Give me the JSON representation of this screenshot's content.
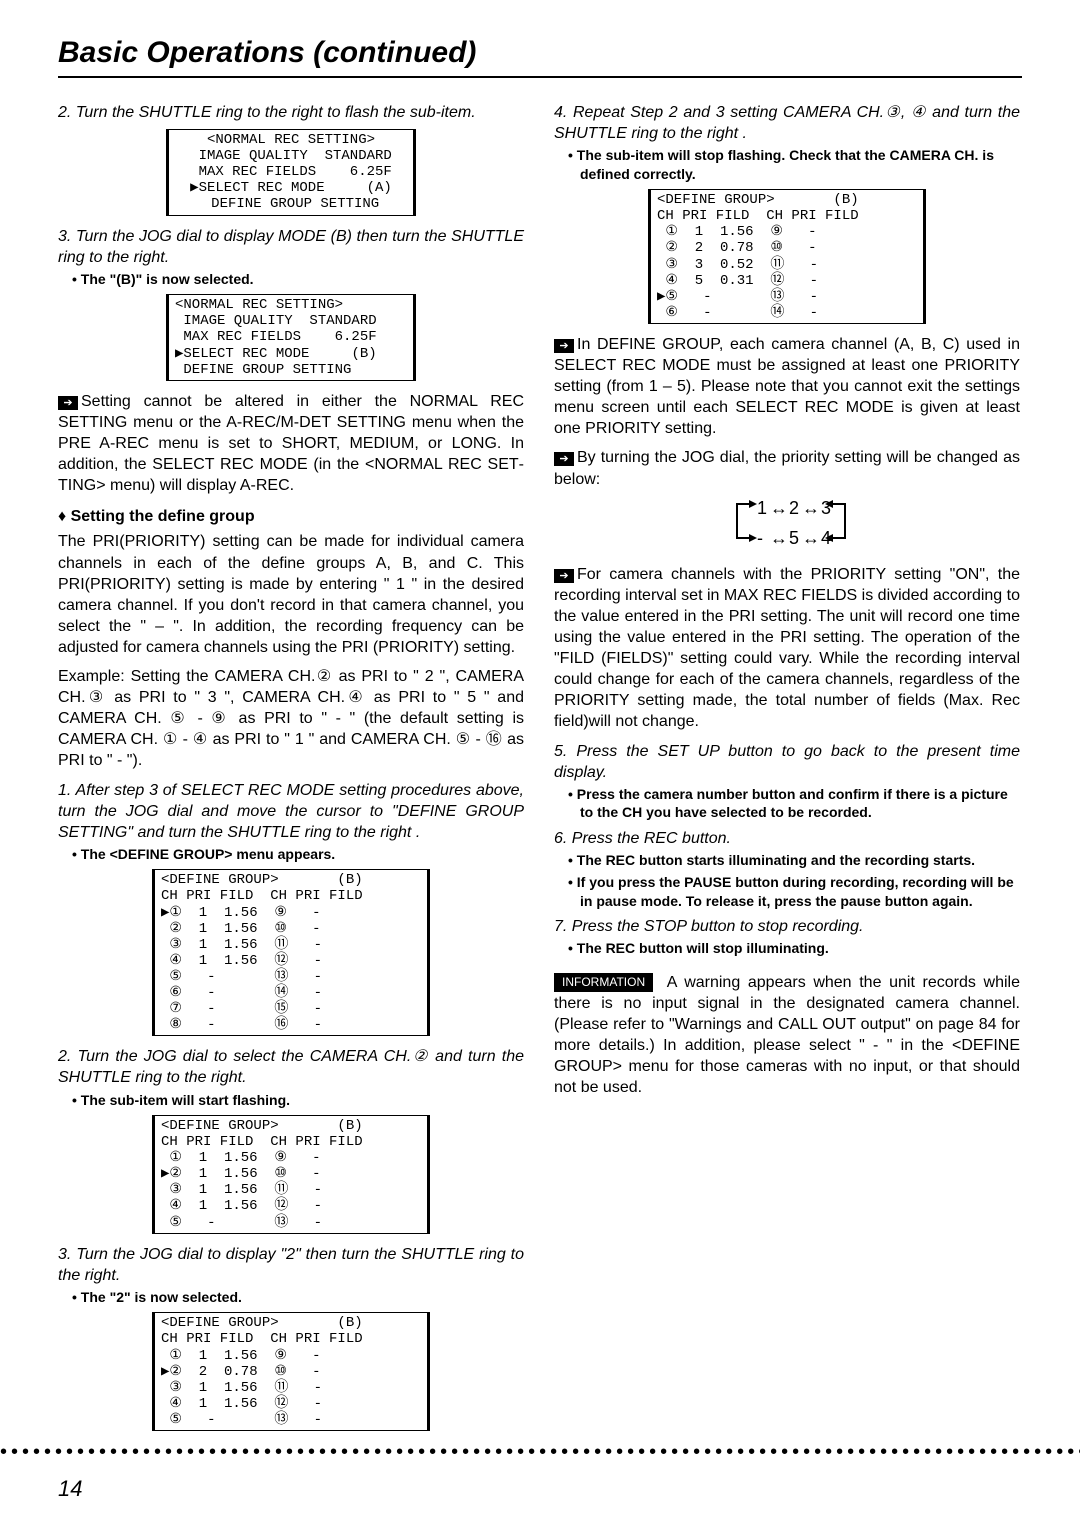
{
  "header": {
    "title": "Basic Operations (continued)"
  },
  "left": {
    "step2": "2. Turn the SHUTTLE ring to the right to flash the sub-item.",
    "menu1": "<NORMAL REC SETTING>\n IMAGE QUALITY  STANDARD\n MAX REC FIELDS    6.25F\n▶SELECT REC MODE     (A)\n DEFINE GROUP SETTING",
    "step3": "3. Turn the JOG dial to display MODE (B) then turn the SHUTTLE ring to the right.",
    "bullet3": "• The \"(B)\" is now selected.",
    "menu2": "<NORMAL REC SETTING>\n IMAGE QUALITY  STANDARD\n MAX REC FIELDS    6.25F\n▶SELECT REC MODE     (B)\n DEFINE GROUP SETTING",
    "note1": "Setting cannot be altered in either the NORMAL REC SETTING menu or the A-REC/M-DET SET­TING menu when the PRE A-REC menu is set to SHORT, MEDIUM, or LONG. In addition, the SE­LECT REC MODE (in the <NORMAL REC SET­TING> menu) will display A-REC.",
    "diamond": "♦ Setting the define group",
    "body1": "The PRI(PRIORITY) setting can be made for individual camera channels in each of the define groups A, B, and C. This PRI(PRIORITY) setting is made by entering \" 1 \" in the desired camera channel. If you don't record in that camera channel, you select the  \" – \". In addition, the re­cording frequency can be adjusted for camera channels using the PRI (PRIORITY) setting.",
    "example": "Example: Setting the CAMERA CH.② as PRI to \" 2 \", CAM­ERA CH.③ as PRI to \" 3 \", CAMERA CH.④ as PRI to \" 5 \"  and CAMERA CH. ⑤ - ⑨ as PRI to \" - \" (the default set­ting is CAMERA CH. ① - ④ as PRI to \" 1 \" and CAMERA CH. ⑤ - ⑯ as PRI to \" - \").",
    "dg_step1": "1. After step 3 of SELECT REC MODE setting procedures above, turn the JOG dial and move  the cursor to \"DEFINE GROUP SETTING\" and turn the SHUTTLE ring to the right .",
    "dg_bullet1": "• The <DEFINE GROUP> menu appears.",
    "menu3": "<DEFINE GROUP>       (B)\nCH PRI FILD  CH PRI FILD\n▶①  1  1.56  ⑨   -\n ②  1  1.56  ⑩   -\n ③  1  1.56  ⑪   -\n ④  1  1.56  ⑫   -\n ⑤   -       ⑬   -\n ⑥   -       ⑭   -\n ⑦   -       ⑮   -\n ⑧   -       ⑯   -",
    "dg_step2": "2. Turn the JOG dial to select the CAMERA CH.② and turn the SHUTTLE ring to the right.",
    "dg_bullet2": "• The sub-item will start flashing.",
    "menu4": "<DEFINE GROUP>       (B)\nCH PRI FILD  CH PRI FILD\n ①  1  1.56  ⑨   -\n▶②  1  1.56  ⑩   -\n ③  1  1.56  ⑪   -\n ④  1  1.56  ⑫   -\n ⑤   -       ⑬   -",
    "dg_step3": "3. Turn the JOG dial to display \"2\" then turn the SHUTTLE ring to the right.",
    "dg_bullet3": "• The \"2\" is now selected.",
    "menu5": "<DEFINE GROUP>       (B)\nCH PRI FILD  CH PRI FILD\n ①  1  1.56  ⑨   -\n▶②  2  0.78  ⑩   -\n ③  1  1.56  ⑪   -\n ④  1  1.56  ⑫   -\n ⑤   -       ⑬   -"
  },
  "right": {
    "step4": "4. Repeat Step 2 and 3 setting CAMERA CH.③, ④ and turn the SHUTTLE ring to the right .",
    "bullet4": "• The sub-item will stop flashing. Check that the CAMERA CH. is defined correctly.",
    "menu6": "<DEFINE GROUP>       (B)\nCH PRI FILD  CH PRI FILD\n ①  1  1.56  ⑨   -\n ②  2  0.78  ⑩   -\n ③  3  0.52  ⑪   -\n ④  5  0.31  ⑫   -\n▶⑤   -       ⑬   -\n ⑥   -       ⑭   -",
    "note2": "In DEFINE GROUP, each camera channel (A, B, C) used in SELECT REC MODE must be assigned at least one PRIORITY setting (from 1 – 5). Please note that you cannot exit the settings menu screen until each SELECT REC MODE is given at least one PRIORITY setting.",
    "note3": "By turning the JOG dial, the priority setting will be changed as below:",
    "prio_seq": "1 ↔ 2 ↔ 3\n- ↔ 5 ↔ 4",
    "note4": "For camera channels with the PRIORITY setting \"ON\", the recording interval set in MAX REC FIELDS is divided according to the value entered in the PRI setting. The unit will record one time using the value entered in the PRI setting. The operation of the \"FILD (FIELDS)\" setting could vary. While the recording interval could change for each of the camera chan­nels, regardless of the PRIORITY setting made, the total number of fields (Max. Rec field)will not change.",
    "step5": "5. Press the SET UP button to go back to the present time display.",
    "bullet5": "• Press the camera number button and confirm if there is a picture to the CH you have selected to be recorded.",
    "step6": "6. Press the REC button.",
    "bullet6a": "• The REC button starts illuminating and the recording starts.",
    "bullet6b": "• If you press the PAUSE button during recording, recording will be in pause mode. To release it, press the pause button again.",
    "step7": "7. Press the STOP button to stop recording.",
    "bullet7": "• The REC button will stop illuminating.",
    "info_label": "INFORMATION",
    "info_body": "A warning appears when the unit records while there is no input signal in the desig­nated camera channel. (Please refer to \"Warnings and CALL OUT output\" on page 84 for more de­tails.) In addition, please select \" - \" in the <DEFINE GROUP> menu for those cameras with no input, or that should not be used."
  },
  "page_number": "14"
}
